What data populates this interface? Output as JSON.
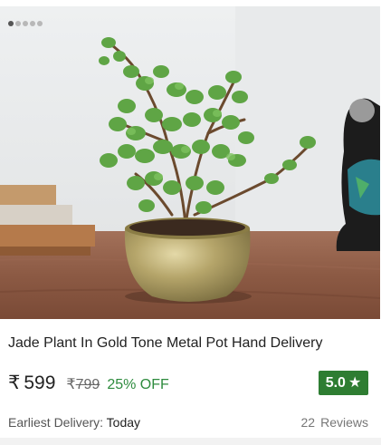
{
  "carousel": {
    "total": 5,
    "active_index": 0
  },
  "product": {
    "title": "Jade Plant In Gold Tone Metal Pot Hand Delivery",
    "currency_symbol": "₹",
    "price": "599",
    "mrp_symbol": "₹",
    "mrp": "799",
    "discount": "25% OFF",
    "rating": "5.0",
    "rating_icon": "star-icon",
    "delivery_label": "Earliest Delivery:",
    "delivery_day": "Today",
    "review_count": "22",
    "reviews_label": "Reviews"
  },
  "colors": {
    "discount": "#2e8b3e",
    "rating_badge": "#2e7d32"
  }
}
